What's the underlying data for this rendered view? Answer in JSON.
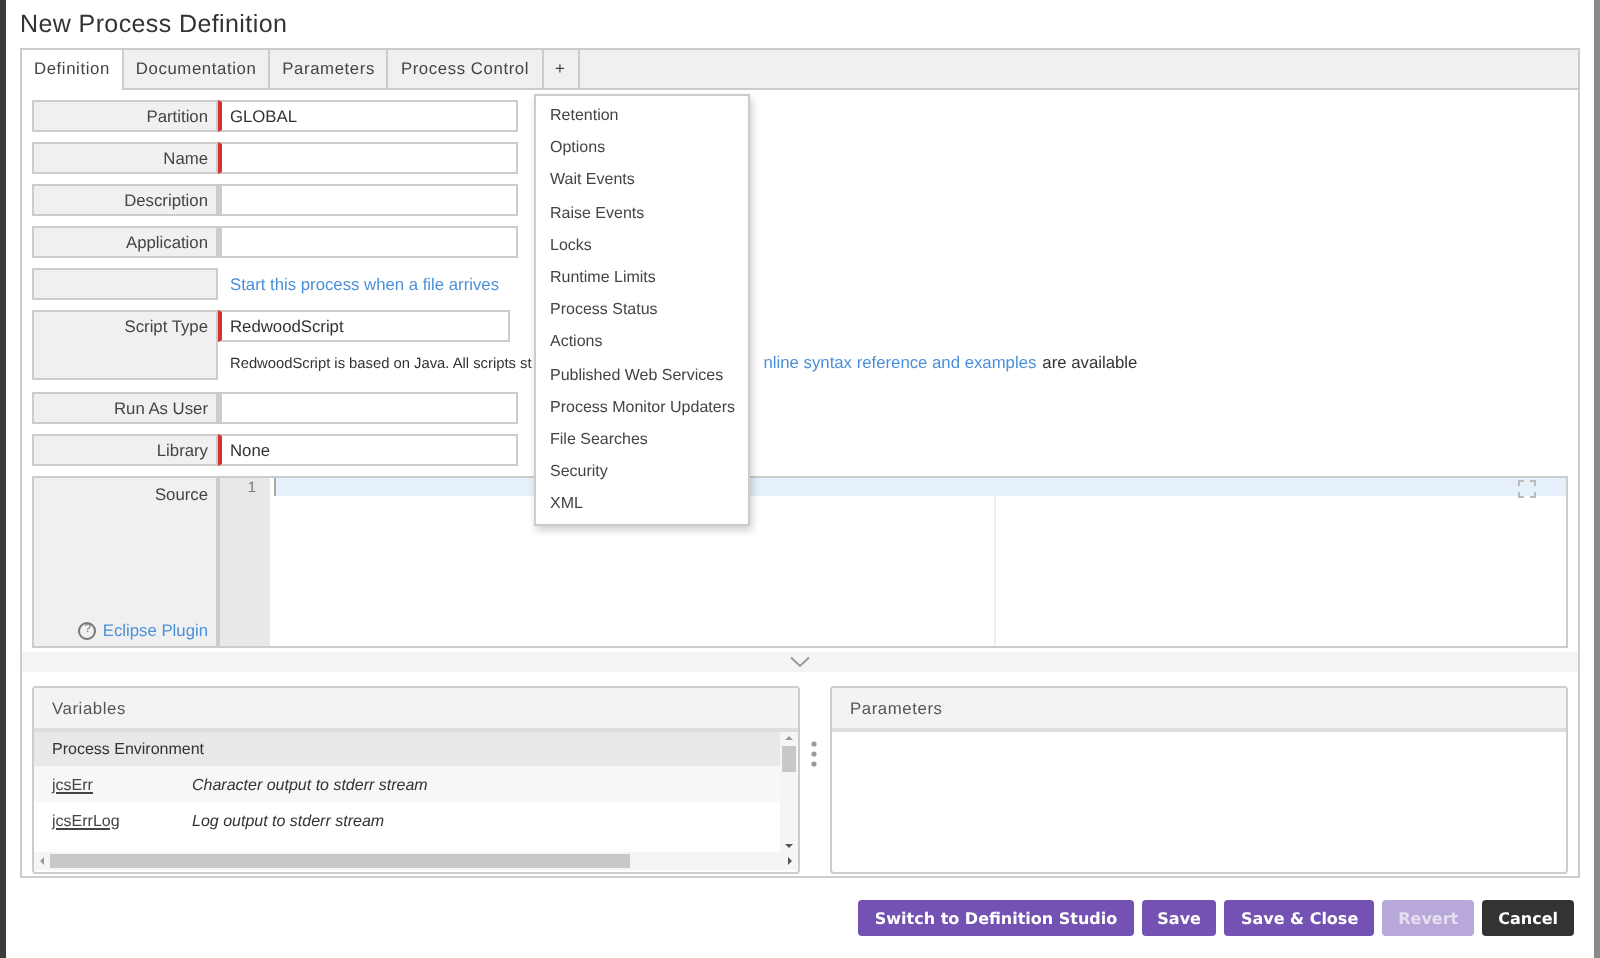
{
  "window": {
    "title": "New Process Definition"
  },
  "tabs": [
    {
      "label": "Definition",
      "selected": true
    },
    {
      "label": "Documentation",
      "selected": false
    },
    {
      "label": "Parameters",
      "selected": false
    },
    {
      "label": "Process Control",
      "selected": false
    },
    {
      "label": "+",
      "selected": false
    }
  ],
  "tab_menu": {
    "items": [
      "Retention",
      "Options",
      "Wait Events",
      "Raise Events",
      "Locks",
      "Runtime Limits",
      "Process Status",
      "Actions",
      "Published Web Services",
      "Process Monitor Updaters",
      "File Searches",
      "Security",
      "XML"
    ]
  },
  "form": {
    "rows": [
      {
        "kind": "field",
        "label": "Partition",
        "value": "GLOBAL",
        "required": true
      },
      {
        "kind": "field",
        "label": "Name",
        "required": true
      },
      {
        "kind": "field",
        "label": "Description",
        "required": false
      },
      {
        "kind": "field",
        "label": "Application",
        "required": false
      },
      {
        "kind": "link",
        "link": "Start this process when a file arrives"
      },
      {
        "kind": "script",
        "label": "Script Type",
        "value": "RedwoodScript",
        "required": true,
        "note_start": "RedwoodScript is based on Java. All scripts st",
        "note_link": "nline syntax reference and examples",
        "note_end": "are available"
      },
      {
        "kind": "field",
        "label": "Run As User",
        "required": false
      },
      {
        "kind": "field",
        "label": "Library",
        "value": "None",
        "required": true
      },
      {
        "kind": "editor",
        "label": "Source",
        "line_number": "1",
        "help_icon": "?",
        "help_link": "Eclipse Plugin"
      }
    ]
  },
  "variables": {
    "title": "Variables",
    "group": "Process Environment",
    "rows": [
      {
        "name": "jcsErr",
        "description": "Character output to stderr stream"
      },
      {
        "name": "jcsErrLog",
        "description": "Log output to stderr stream"
      }
    ]
  },
  "parameters": {
    "title": "Parameters"
  },
  "buttons": [
    {
      "label": "Switch to Definition Studio",
      "kind": "primary",
      "disabled": false
    },
    {
      "label": "Save",
      "kind": "primary",
      "disabled": false
    },
    {
      "label": "Save & Close",
      "kind": "primary",
      "disabled": false
    },
    {
      "label": "Revert",
      "kind": "primary",
      "disabled": true
    },
    {
      "label": "Cancel",
      "kind": "dark",
      "disabled": false
    }
  ]
}
